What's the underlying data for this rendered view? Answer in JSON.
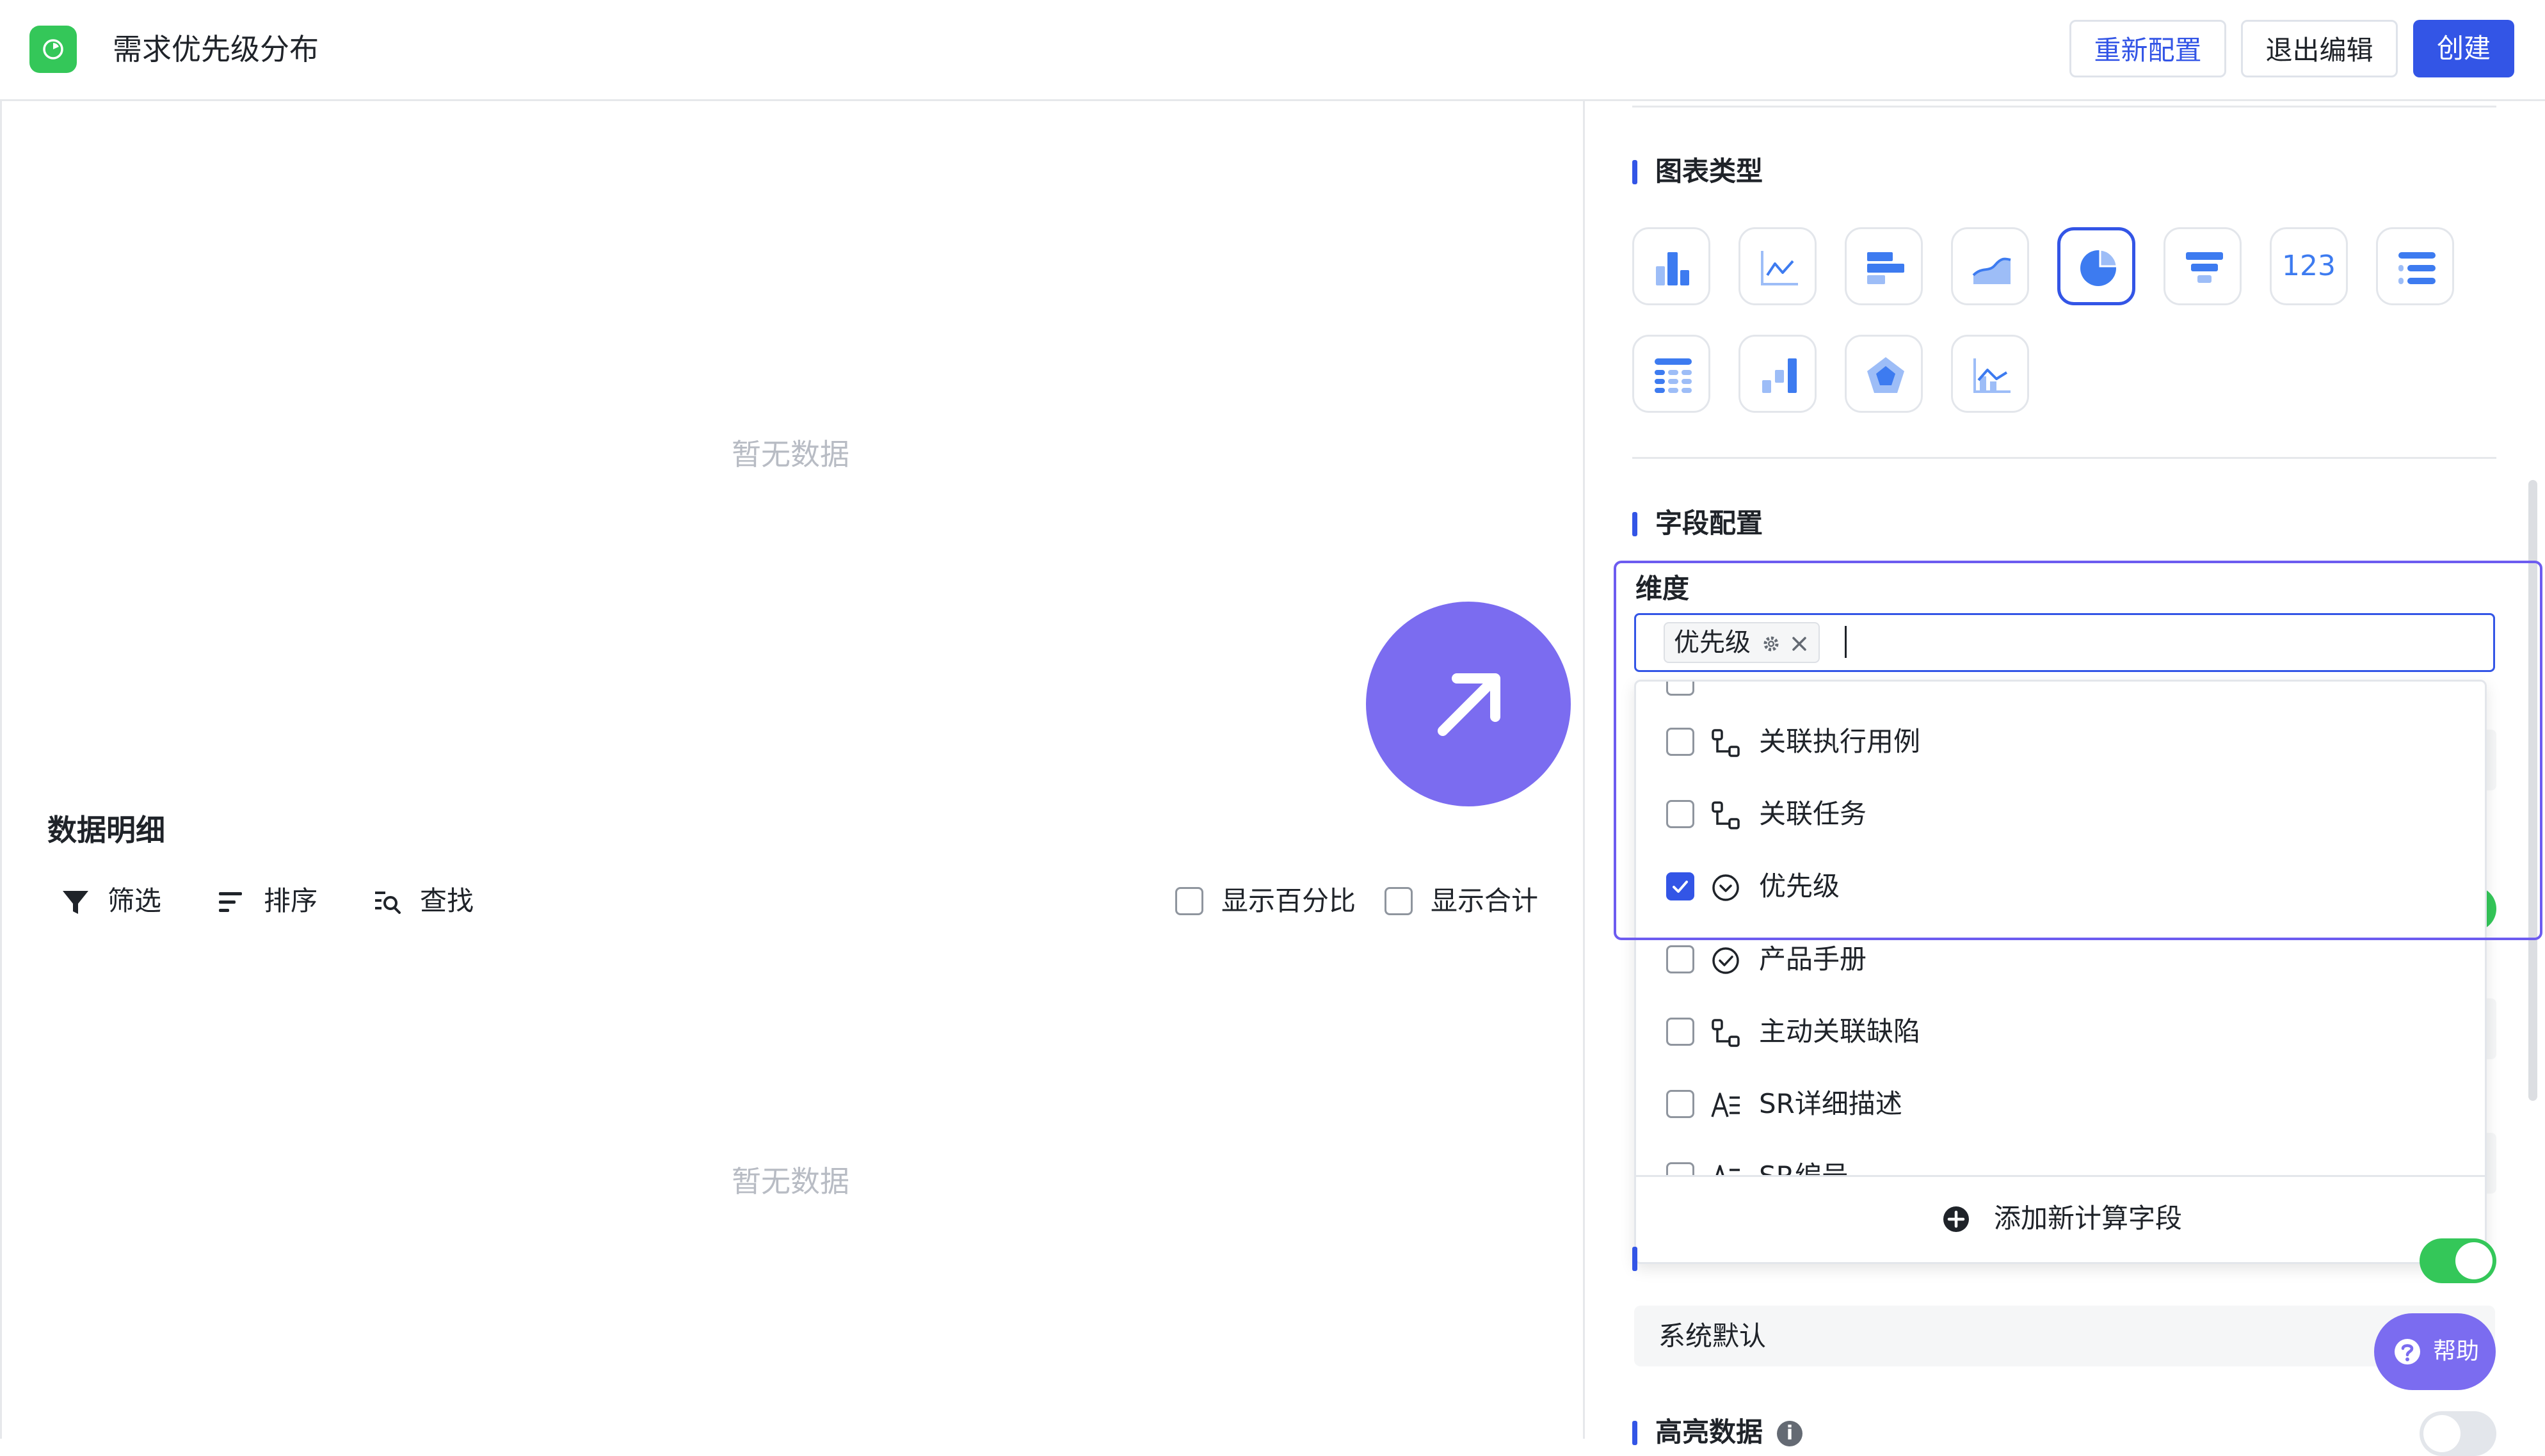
{
  "header": {
    "title": "需求优先级分布",
    "reconfigure_label": "重新配置",
    "exit_edit_label": "退出编辑",
    "create_label": "创建",
    "accent_color": "#3355e6"
  },
  "preview": {
    "chart_empty_text": "暂无数据",
    "detail_title": "数据明细",
    "toolbar": {
      "filter_label": "筛选",
      "sort_label": "排序",
      "find_label": "查找"
    },
    "show_percent_label": "显示百分比",
    "show_total_label": "显示合计",
    "detail_empty_text": "暂无数据"
  },
  "config": {
    "chart_type_title": "图表类型",
    "chart_types": [
      {
        "name": "column",
        "selected": false
      },
      {
        "name": "line",
        "selected": false
      },
      {
        "name": "bar",
        "selected": false
      },
      {
        "name": "area",
        "selected": false
      },
      {
        "name": "pie",
        "selected": true
      },
      {
        "name": "funnel",
        "selected": false
      },
      {
        "name": "number",
        "selected": false,
        "text": "123"
      },
      {
        "name": "list",
        "selected": false
      },
      {
        "name": "table",
        "selected": false
      },
      {
        "name": "waterfall",
        "selected": false
      },
      {
        "name": "radar",
        "selected": false
      },
      {
        "name": "combo",
        "selected": false
      }
    ],
    "field_config_title": "字段配置",
    "dimension_label": "维度",
    "dimension_tag": "优先级",
    "theme_value": "系统默认",
    "highlight_label": "高亮数据"
  },
  "dropdown": {
    "items": [
      {
        "label": "关联执行用例",
        "icon": "relation-icon",
        "checked": false
      },
      {
        "label": "关联任务",
        "icon": "relation-icon",
        "checked": false
      },
      {
        "label": "优先级",
        "icon": "single-select-icon",
        "checked": true
      },
      {
        "label": "产品手册",
        "icon": "single-select-icon",
        "checked": false
      },
      {
        "label": "主动关联缺陷",
        "icon": "relation-icon",
        "checked": false
      },
      {
        "label": "SR详细描述",
        "icon": "text-icon",
        "checked": false
      },
      {
        "label": "SR编号",
        "icon": "text-icon",
        "checked": false
      }
    ],
    "add_field_label": "添加新计算字段"
  },
  "help": {
    "label": "帮助"
  }
}
